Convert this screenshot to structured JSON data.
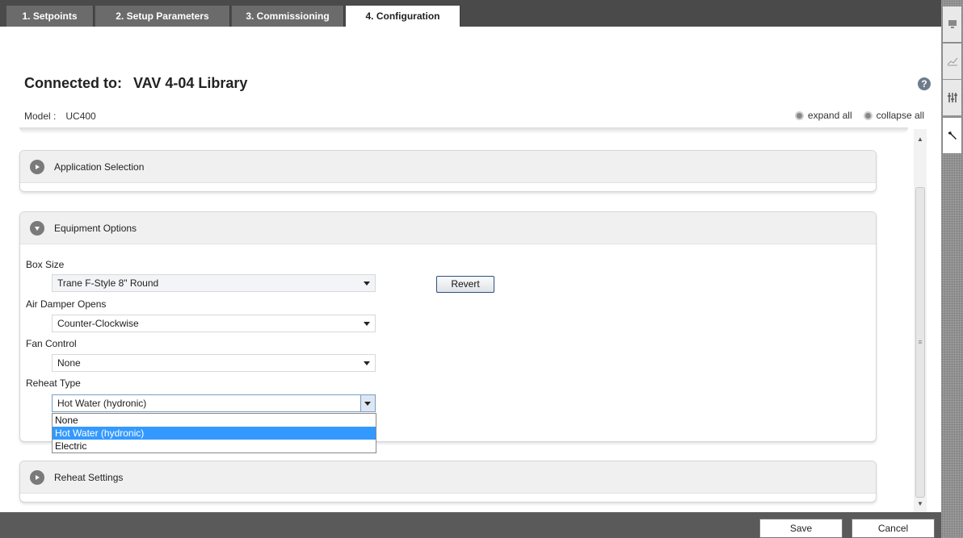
{
  "tabs": [
    {
      "label": "1. Setpoints"
    },
    {
      "label": "2. Setup Parameters"
    },
    {
      "label": "3. Commissioning"
    },
    {
      "label": "4. Configuration",
      "active": true
    }
  ],
  "header": {
    "connected_label": "Connected to:",
    "device_name": "VAV 4-04 Library",
    "model_label": "Model :",
    "model_value": "UC400",
    "help_glyph": "?",
    "expand_all": "expand all",
    "collapse_all": "collapse all"
  },
  "panels": {
    "application_selection": {
      "title": "Application Selection",
      "expanded": false
    },
    "equipment_options": {
      "title": "Equipment Options",
      "expanded": true,
      "box_size": {
        "label": "Box Size",
        "value": "Trane F-Style 8\" Round"
      },
      "revert_label": "Revert",
      "air_damper": {
        "label": "Air Damper Opens",
        "value": "Counter-Clockwise"
      },
      "fan_control": {
        "label": "Fan Control",
        "value": "None"
      },
      "reheat_type": {
        "label": "Reheat Type",
        "value": "Hot Water (hydronic)",
        "options": [
          "None",
          "Hot Water (hydronic)",
          "Electric"
        ],
        "selected_index": 1
      }
    },
    "reheat_settings": {
      "title": "Reheat Settings",
      "expanded": false
    }
  },
  "footer": {
    "save_label": "Save",
    "cancel_label": "Cancel"
  },
  "rail_icons": [
    "monitor-icon",
    "chart-icon",
    "sliders-icon",
    "wrench-icon"
  ],
  "colors": {
    "tabbar": "#4a4a4a",
    "active_tab": "#ffffff",
    "selection": "#3399ff",
    "bottombar": "#5a5a5a"
  }
}
